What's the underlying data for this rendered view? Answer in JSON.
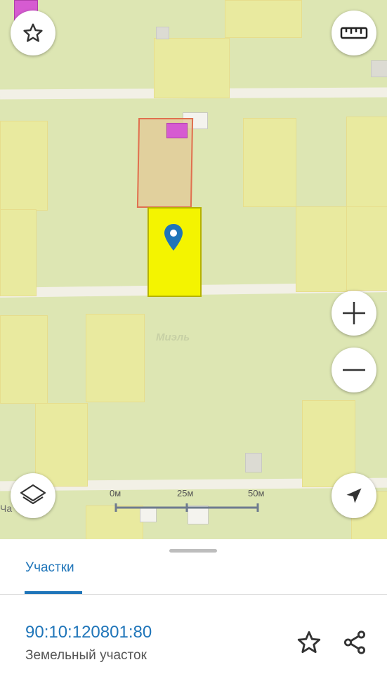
{
  "map": {
    "scale": {
      "labels": [
        "0м",
        "25м",
        "50м"
      ]
    },
    "watermark": "Миэль",
    "road_label_fragment": "Ча",
    "controls": {
      "favorite": "star-icon",
      "ruler": "ruler-icon",
      "zoom_in": "plus-icon",
      "zoom_out": "minus-icon",
      "layers": "layers-icon",
      "locate": "navigation-arrow-icon"
    },
    "colors": {
      "selected_parcel": "#f4f400",
      "marker": "#1f75b9",
      "highlighted_parcel_border": "#e0704f",
      "building_magenta": "#d65bd1"
    }
  },
  "sheet": {
    "tab_label": "Участки",
    "parcel": {
      "cadastral_number": "90:10:120801:80",
      "type": "Земельный участок"
    },
    "actions": {
      "favorite": "star-icon",
      "share": "share-icon"
    }
  }
}
